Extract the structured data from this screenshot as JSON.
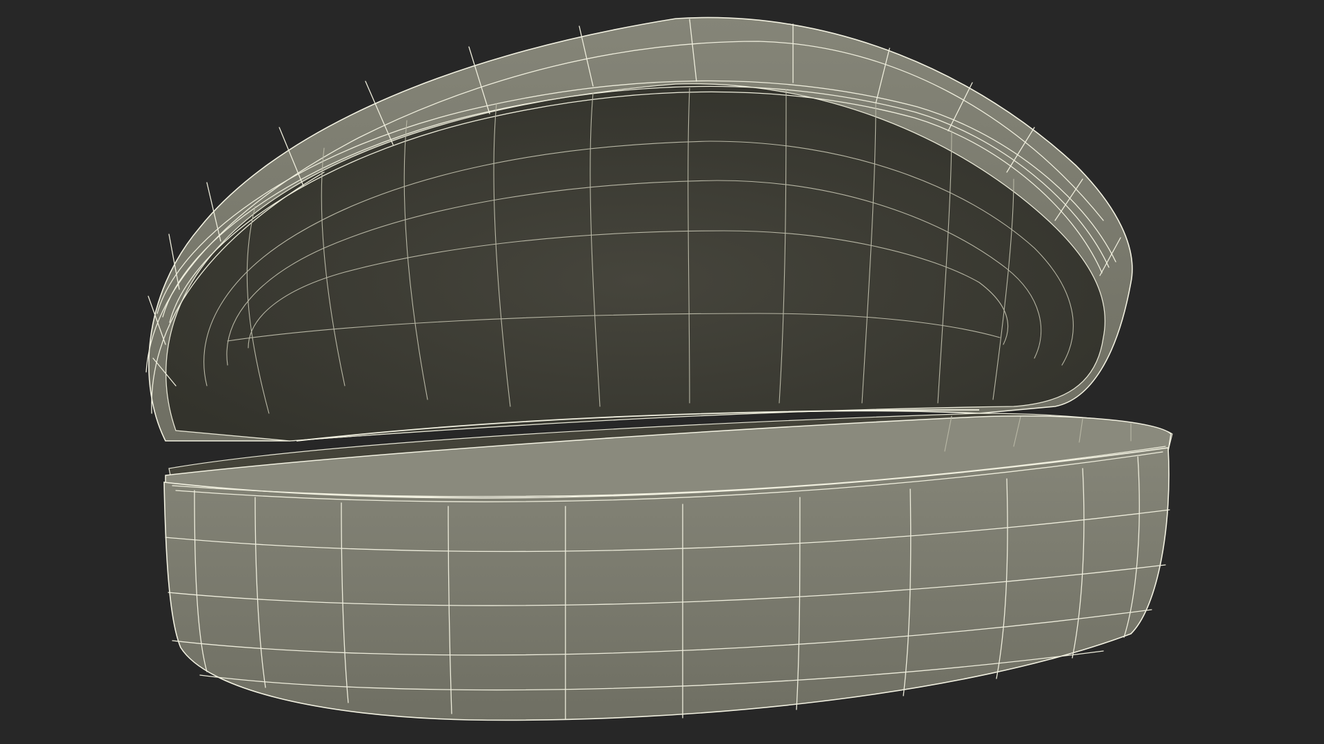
{
  "scene": {
    "subject": "open-eyeglass-case-wireframe",
    "background_color": "#272727",
    "shell_outer_color": "#7c7c6f",
    "shell_inner_color": "#403f37",
    "wire_color": "#efeedd"
  }
}
